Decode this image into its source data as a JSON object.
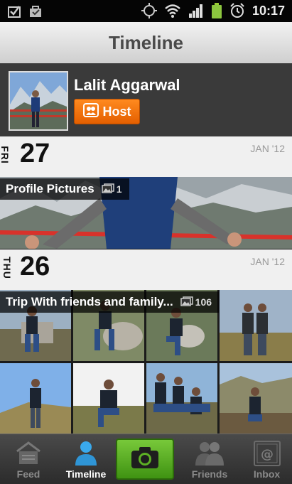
{
  "status_bar": {
    "time": "10:17",
    "left_icons": [
      "checkbox-notification-icon",
      "bag-notification-icon"
    ],
    "right_icons": [
      "gps-icon",
      "wifi-icon",
      "signal-icon",
      "battery-icon",
      "alarm-icon"
    ]
  },
  "header": {
    "title": "Timeline"
  },
  "profile": {
    "name": "Lalit Aggarwal",
    "host_label": "Host"
  },
  "days": [
    {
      "weekday": "FRI",
      "day": "27",
      "month": "JAN '12",
      "album": {
        "title": "Profile Pictures",
        "count": "1"
      }
    },
    {
      "weekday": "THU",
      "day": "26",
      "month": "JAN '12",
      "album": {
        "title": "Trip With friends and family...",
        "count": "106"
      }
    }
  ],
  "tabs": [
    {
      "label": "Feed",
      "icon": "feed-icon",
      "active": false
    },
    {
      "label": "Timeline",
      "icon": "person-icon",
      "active": true
    },
    {
      "label": "",
      "icon": "camera-icon",
      "active": false
    },
    {
      "label": "Friends",
      "icon": "friends-icon",
      "active": false
    },
    {
      "label": "Inbox",
      "icon": "inbox-icon",
      "active": false
    }
  ],
  "colors": {
    "accent_orange": "#f47a12",
    "camera_green": "#5cb024",
    "active_tab_blue": "#2fa3e6"
  }
}
